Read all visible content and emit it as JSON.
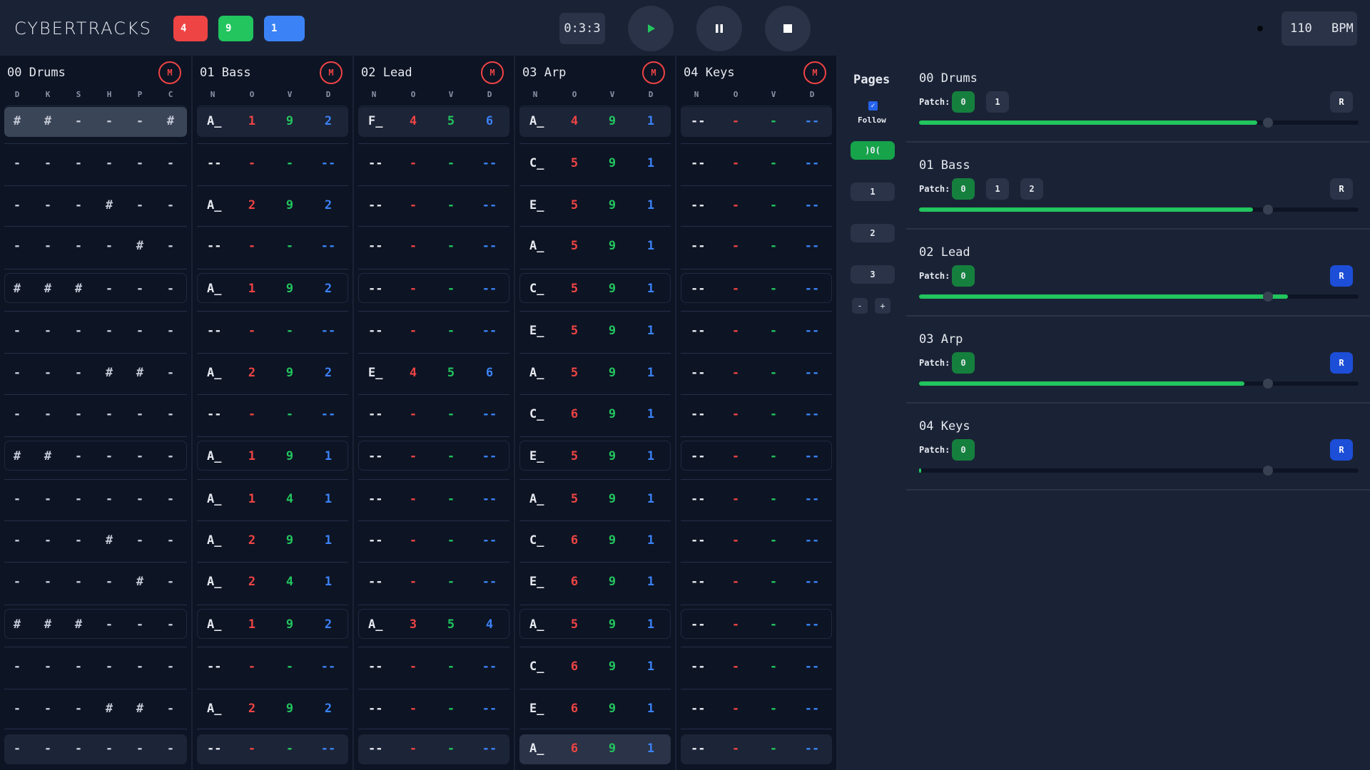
{
  "app": {
    "logo": "CYBERTRACKS"
  },
  "header": {
    "chips": [
      {
        "label": "4",
        "color": "#ef4444"
      },
      {
        "label": "9",
        "color": "#22c55e"
      },
      {
        "label": "1",
        "color": "#3b82f6"
      }
    ],
    "time": "0:3:3",
    "play_icon": "play-icon",
    "pause_icon": "pause-icon",
    "stop_icon": "stop-icon",
    "bpm_value": "110",
    "bpm_label": "BPM"
  },
  "tracks": [
    {
      "title": "00 Drums",
      "mute": "M",
      "columns": [
        "D",
        "K",
        "S",
        "H",
        "P",
        "C"
      ],
      "type": "drums",
      "rows": [
        [
          "#",
          "#",
          "-",
          "-",
          "-",
          "#"
        ],
        [
          "-",
          "-",
          "-",
          "-",
          "-",
          "-"
        ],
        [
          "-",
          "-",
          "-",
          "#",
          "-",
          "-"
        ],
        [
          "-",
          "-",
          "-",
          "-",
          "#",
          "-"
        ],
        [
          "#",
          "#",
          "#",
          "-",
          "-",
          "-"
        ],
        [
          "-",
          "-",
          "-",
          "-",
          "-",
          "-"
        ],
        [
          "-",
          "-",
          "-",
          "#",
          "#",
          "-"
        ],
        [
          "-",
          "-",
          "-",
          "-",
          "-",
          "-"
        ],
        [
          "#",
          "#",
          "-",
          "-",
          "-",
          "-"
        ],
        [
          "-",
          "-",
          "-",
          "-",
          "-",
          "-"
        ],
        [
          "-",
          "-",
          "-",
          "#",
          "-",
          "-"
        ],
        [
          "-",
          "-",
          "-",
          "-",
          "#",
          "-"
        ],
        [
          "#",
          "#",
          "#",
          "-",
          "-",
          "-"
        ],
        [
          "-",
          "-",
          "-",
          "-",
          "-",
          "-"
        ],
        [
          "-",
          "-",
          "-",
          "#",
          "#",
          "-"
        ],
        [
          "-",
          "-",
          "-",
          "-",
          "-",
          "-"
        ]
      ]
    },
    {
      "title": "01 Bass",
      "mute": "M",
      "columns": [
        "N",
        "O",
        "V",
        "D"
      ],
      "type": "notes",
      "rows": [
        [
          "A_",
          "1",
          "9",
          "2"
        ],
        [
          "--",
          "-",
          "-",
          "--"
        ],
        [
          "A_",
          "2",
          "9",
          "2"
        ],
        [
          "--",
          "-",
          "-",
          "--"
        ],
        [
          "A_",
          "1",
          "9",
          "2"
        ],
        [
          "--",
          "-",
          "-",
          "--"
        ],
        [
          "A_",
          "2",
          "9",
          "2"
        ],
        [
          "--",
          "-",
          "-",
          "--"
        ],
        [
          "A_",
          "1",
          "9",
          "1"
        ],
        [
          "A_",
          "1",
          "4",
          "1"
        ],
        [
          "A_",
          "2",
          "9",
          "1"
        ],
        [
          "A_",
          "2",
          "4",
          "1"
        ],
        [
          "A_",
          "1",
          "9",
          "2"
        ],
        [
          "--",
          "-",
          "-",
          "--"
        ],
        [
          "A_",
          "2",
          "9",
          "2"
        ],
        [
          "--",
          "-",
          "-",
          "--"
        ]
      ]
    },
    {
      "title": "02 Lead",
      "mute": "M",
      "columns": [
        "N",
        "O",
        "V",
        "D"
      ],
      "type": "notes",
      "rows": [
        [
          "F_",
          "4",
          "5",
          "6"
        ],
        [
          "--",
          "-",
          "-",
          "--"
        ],
        [
          "--",
          "-",
          "-",
          "--"
        ],
        [
          "--",
          "-",
          "-",
          "--"
        ],
        [
          "--",
          "-",
          "-",
          "--"
        ],
        [
          "--",
          "-",
          "-",
          "--"
        ],
        [
          "E_",
          "4",
          "5",
          "6"
        ],
        [
          "--",
          "-",
          "-",
          "--"
        ],
        [
          "--",
          "-",
          "-",
          "--"
        ],
        [
          "--",
          "-",
          "-",
          "--"
        ],
        [
          "--",
          "-",
          "-",
          "--"
        ],
        [
          "--",
          "-",
          "-",
          "--"
        ],
        [
          "A_",
          "3",
          "5",
          "4"
        ],
        [
          "--",
          "-",
          "-",
          "--"
        ],
        [
          "--",
          "-",
          "-",
          "--"
        ],
        [
          "--",
          "-",
          "-",
          "--"
        ]
      ]
    },
    {
      "title": "03 Arp",
      "mute": "M",
      "columns": [
        "N",
        "O",
        "V",
        "D"
      ],
      "type": "notes",
      "rows": [
        [
          "A_",
          "4",
          "9",
          "1"
        ],
        [
          "C_",
          "5",
          "9",
          "1"
        ],
        [
          "E_",
          "5",
          "9",
          "1"
        ],
        [
          "A_",
          "5",
          "9",
          "1"
        ],
        [
          "C_",
          "5",
          "9",
          "1"
        ],
        [
          "E_",
          "5",
          "9",
          "1"
        ],
        [
          "A_",
          "5",
          "9",
          "1"
        ],
        [
          "C_",
          "6",
          "9",
          "1"
        ],
        [
          "E_",
          "5",
          "9",
          "1"
        ],
        [
          "A_",
          "5",
          "9",
          "1"
        ],
        [
          "C_",
          "6",
          "9",
          "1"
        ],
        [
          "E_",
          "6",
          "9",
          "1"
        ],
        [
          "A_",
          "5",
          "9",
          "1"
        ],
        [
          "C_",
          "6",
          "9",
          "1"
        ],
        [
          "E_",
          "6",
          "9",
          "1"
        ],
        [
          "A_",
          "6",
          "9",
          "1"
        ]
      ]
    },
    {
      "title": "04 Keys",
      "mute": "M",
      "columns": [
        "N",
        "O",
        "V",
        "D"
      ],
      "type": "notes",
      "rows": [
        [
          "--",
          "-",
          "-",
          "--"
        ],
        [
          "--",
          "-",
          "-",
          "--"
        ],
        [
          "--",
          "-",
          "-",
          "--"
        ],
        [
          "--",
          "-",
          "-",
          "--"
        ],
        [
          "--",
          "-",
          "-",
          "--"
        ],
        [
          "--",
          "-",
          "-",
          "--"
        ],
        [
          "--",
          "-",
          "-",
          "--"
        ],
        [
          "--",
          "-",
          "-",
          "--"
        ],
        [
          "--",
          "-",
          "-",
          "--"
        ],
        [
          "--",
          "-",
          "-",
          "--"
        ],
        [
          "--",
          "-",
          "-",
          "--"
        ],
        [
          "--",
          "-",
          "-",
          "--"
        ],
        [
          "--",
          "-",
          "-",
          "--"
        ],
        [
          "--",
          "-",
          "-",
          "--"
        ],
        [
          "--",
          "-",
          "-",
          "--"
        ],
        [
          "--",
          "-",
          "-",
          "--"
        ]
      ]
    }
  ],
  "pages": {
    "title": "Pages",
    "follow_label": "Follow",
    "follow_checked": true,
    "link_button": ")0(",
    "buttons": [
      "1",
      "2",
      "3"
    ],
    "minus": "-",
    "plus": "+"
  },
  "patches": [
    {
      "title": "00 Drums",
      "patch_label": "Patch:",
      "buttons": [
        "0",
        "1"
      ],
      "active": 0,
      "r_label": "R",
      "r_active": false,
      "level": 0.77
    },
    {
      "title": "01 Bass",
      "patch_label": "Patch:",
      "buttons": [
        "0",
        "1",
        "2"
      ],
      "active": 0,
      "r_label": "R",
      "r_active": false,
      "level": 0.76
    },
    {
      "title": "02 Lead",
      "patch_label": "Patch:",
      "buttons": [
        "0"
      ],
      "active": 0,
      "r_label": "R",
      "r_active": true,
      "level": 0.84
    },
    {
      "title": "03 Arp",
      "patch_label": "Patch:",
      "buttons": [
        "0"
      ],
      "active": 0,
      "r_label": "R",
      "r_active": true,
      "level": 0.74
    },
    {
      "title": "04 Keys",
      "patch_label": "Patch:",
      "buttons": [
        "0"
      ],
      "active": 0,
      "r_label": "R",
      "r_active": true,
      "level": 0.005
    }
  ],
  "colors": {
    "octave": "#ef4444",
    "velocity": "#22c55e",
    "duration": "#3b82f6",
    "patch_active": "#15803d",
    "record_active": "#1d4ed8"
  }
}
